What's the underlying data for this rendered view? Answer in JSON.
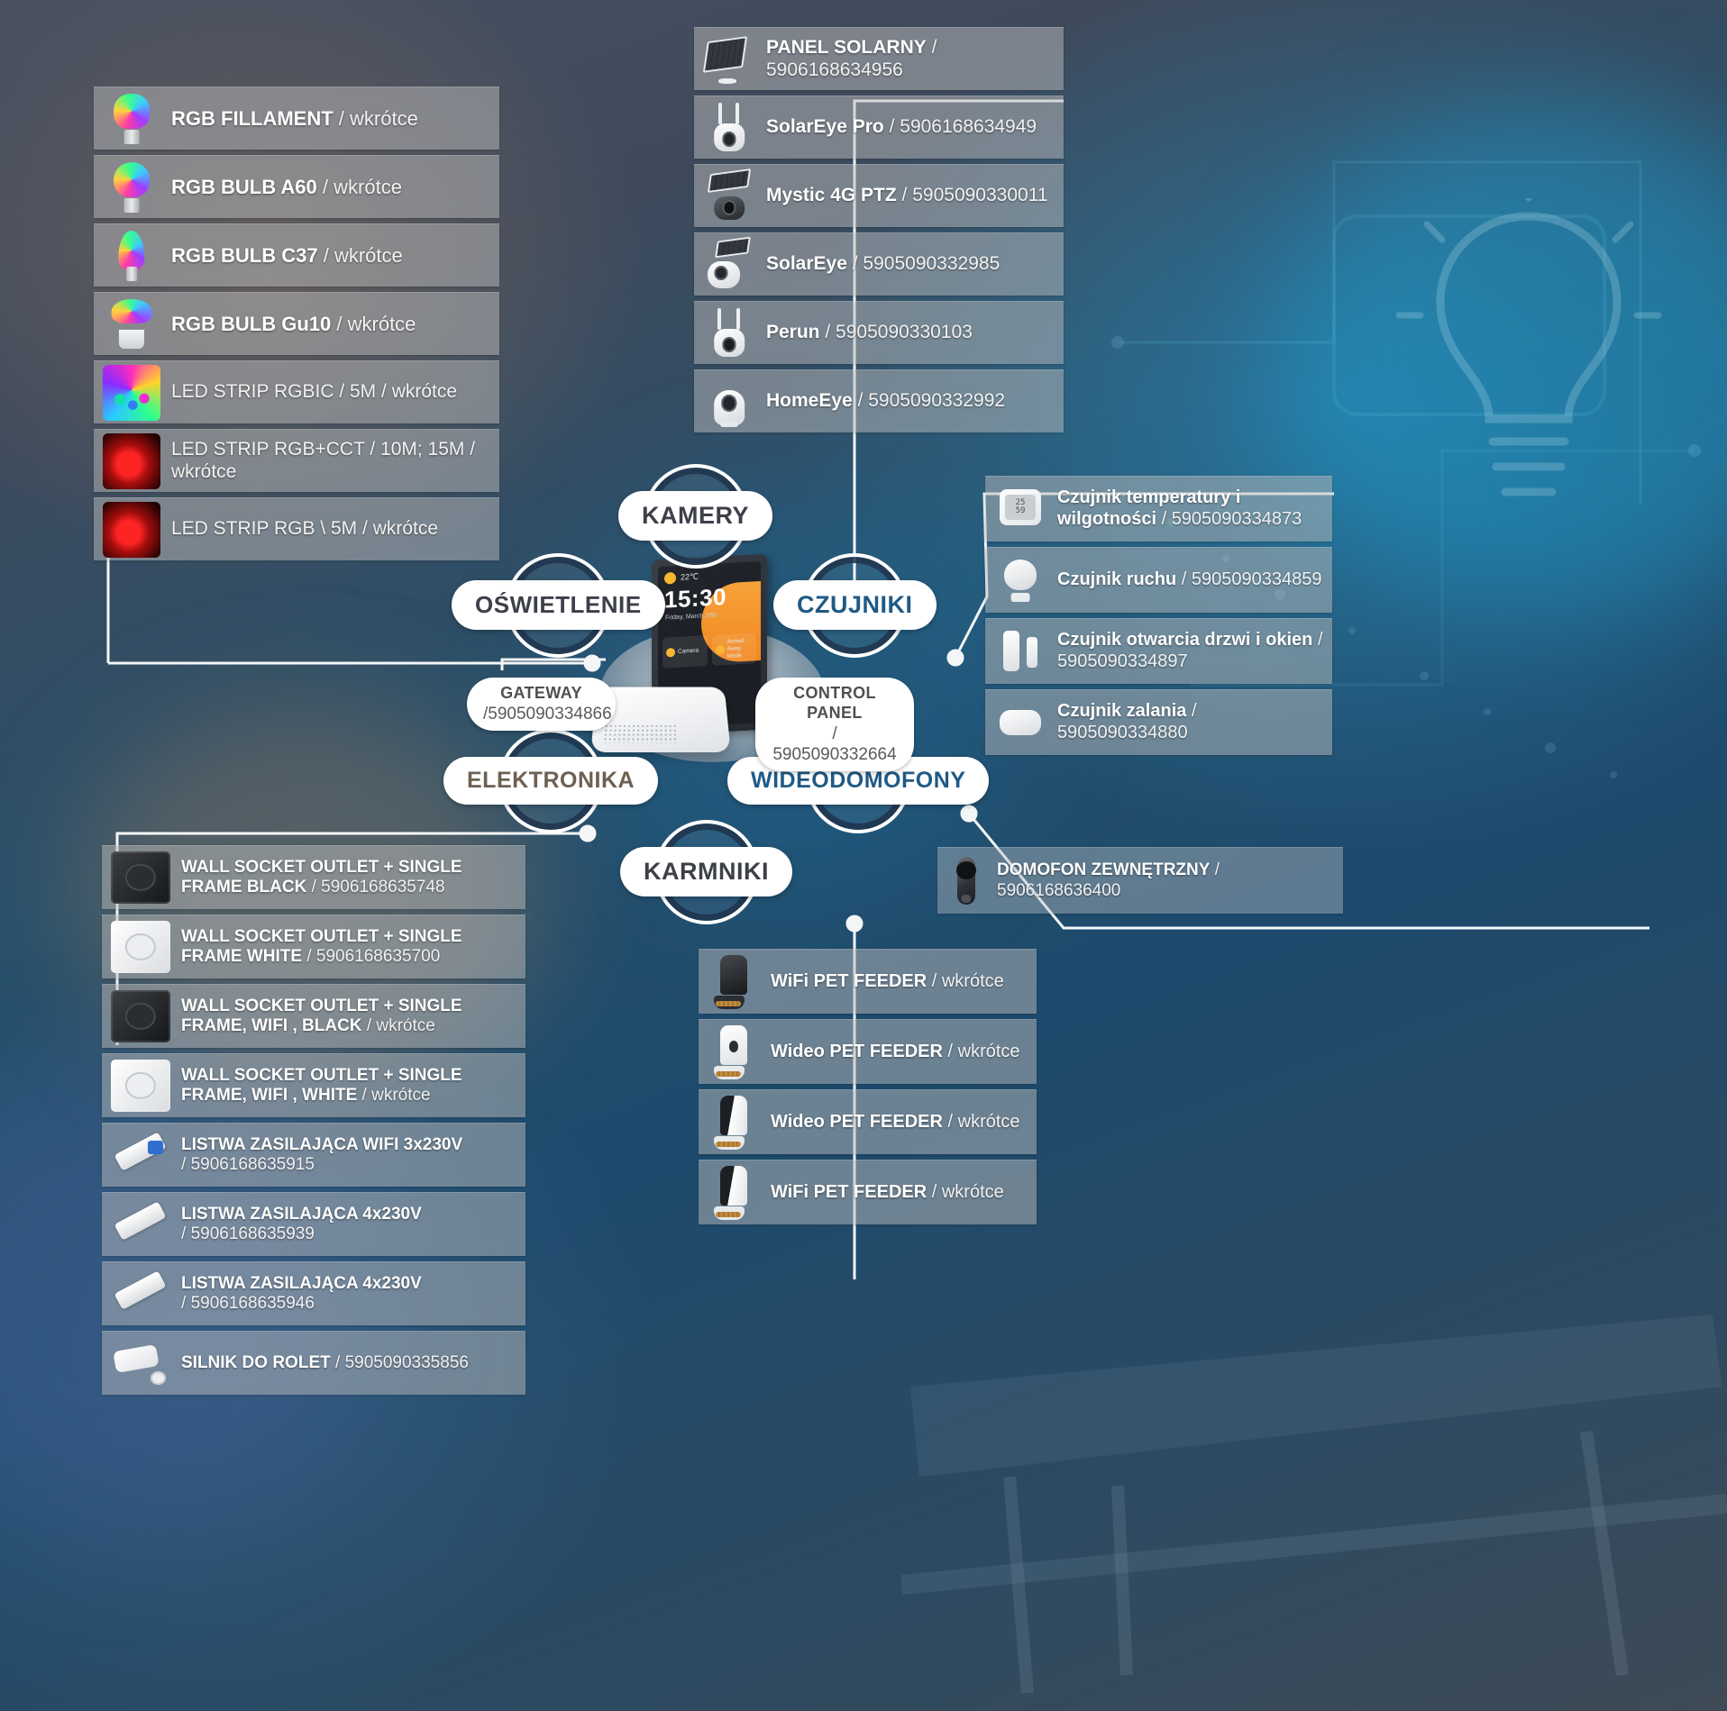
{
  "hub": {
    "nodes": [
      {
        "id": "kamery",
        "label": "KAMERY"
      },
      {
        "id": "oswietlenie",
        "label": "OŚWIETLENIE"
      },
      {
        "id": "czujniki",
        "label": "CZUJNIKI"
      },
      {
        "id": "elektronika",
        "label": "ELEKTRONIKA"
      },
      {
        "id": "wideodomofony",
        "label": "WIDEODOMOFONY"
      },
      {
        "id": "karmniki",
        "label": "KARMNIKI"
      }
    ],
    "gateway": {
      "label": "GATEWAY",
      "code": "/5905090334866"
    },
    "control_panel": {
      "label": "CONTROL PANEL",
      "code": "/ 5905090332664"
    },
    "tablet": {
      "temperature": "22℃",
      "time": "15:30",
      "date": "Friday,  March 28th",
      "card1": "Camera",
      "card2a": "Armed",
      "card2b": "Away Mode"
    }
  },
  "lighting": {
    "items": [
      {
        "name": "RGB FILLAMENT",
        "code": "wkrótce",
        "icon": "rgb-filament-bulb-icon"
      },
      {
        "name": "RGB BULB A60",
        "code": "wkrótce",
        "icon": "rgb-bulb-a60-icon"
      },
      {
        "name": "RGB BULB C37",
        "code": "wkrótce",
        "icon": "rgb-bulb-c37-icon"
      },
      {
        "name": "RGB BULB Gu10",
        "code": "wkrótce",
        "icon": "rgb-bulb-gu10-icon"
      },
      {
        "name": "LED STRIP RGBIC / 5M",
        "code": "wkrótce",
        "icon": "led-strip-rgbic-icon"
      },
      {
        "name": "LED STRIP RGB+CCT / 10M; 15M",
        "code": "wkrótce",
        "icon": "led-strip-rgbcct-icon"
      },
      {
        "name": "LED STRIP RGB \\ 5M",
        "code": "wkrótce",
        "icon": "led-strip-rgb-icon"
      }
    ]
  },
  "cameras": {
    "items": [
      {
        "name": "PANEL SOLARNY",
        "code": "5906168634956",
        "icon": "solar-panel-icon"
      },
      {
        "name": "SolarEye Pro",
        "code": "5906168634949",
        "icon": "ptz-camera-icon"
      },
      {
        "name": "Mystic 4G PTZ",
        "code": "5905090330011",
        "icon": "solar-ptz-camera-icon"
      },
      {
        "name": "SolarEye",
        "code": "5905090332985",
        "icon": "solar-bullet-camera-icon"
      },
      {
        "name": "Perun",
        "code": "5905090330103",
        "icon": "ptz-camera-icon"
      },
      {
        "name": "HomeEye",
        "code": "5905090332992",
        "icon": "indoor-camera-icon"
      }
    ]
  },
  "sensors": {
    "items": [
      {
        "name": "Czujnik temperatury i wilgotności",
        "code": "5905090334873",
        "icon": "temperature-humidity-sensor-icon"
      },
      {
        "name": "Czujnik ruchu",
        "code": "5905090334859",
        "icon": "motion-sensor-icon"
      },
      {
        "name": "Czujnik otwarcia drzwi i okien",
        "code": "5905090334897",
        "icon": "door-window-sensor-icon"
      },
      {
        "name": "Czujnik zalania",
        "code": "5905090334880",
        "icon": "water-leak-sensor-icon"
      }
    ]
  },
  "electronics": {
    "items": [
      {
        "name": "WALL SOCKET OUTLET + SINGLE FRAME BLACK",
        "code": "5906168635748",
        "icon": "wall-socket-black-icon"
      },
      {
        "name": "WALL SOCKET OUTLET + SINGLE FRAME WHITE",
        "code": "5906168635700",
        "icon": "wall-socket-white-icon"
      },
      {
        "name": "WALL SOCKET OUTLET + SINGLE FRAME, WIFI , BLACK",
        "code": "wkrótce",
        "icon": "wall-socket-wifi-black-icon"
      },
      {
        "name": "WALL SOCKET OUTLET + SINGLE FRAME, WIFI , WHITE",
        "code": "wkrótce",
        "icon": "wall-socket-wifi-white-icon"
      },
      {
        "name": "LISTWA ZASILAJĄCA WIFI 3x230V",
        "code": "5906168635915",
        "icon": "power-strip-wifi-icon"
      },
      {
        "name": "LISTWA ZASILAJĄCA 4x230V",
        "code": "5906168635939",
        "icon": "power-strip-icon"
      },
      {
        "name": "LISTWA ZASILAJĄCA 4x230V",
        "code": "5906168635946",
        "icon": "power-strip-icon"
      },
      {
        "name": "SILNIK DO ROLET",
        "code": "5905090335856",
        "icon": "roller-blind-motor-icon"
      }
    ]
  },
  "feeders": {
    "items": [
      {
        "name": "WiFi PET FEEDER",
        "code": "wkrótce",
        "icon": "pet-feeder-black-icon"
      },
      {
        "name": "Wideo PET FEEDER",
        "code": "wkrótce",
        "icon": "video-pet-feeder-white-icon"
      },
      {
        "name": "Wideo PET FEEDER",
        "code": "wkrótce",
        "icon": "video-pet-feeder-icon"
      },
      {
        "name": "WiFi PET FEEDER",
        "code": "wkrótce",
        "icon": "pet-feeder-icon"
      }
    ]
  },
  "doorbell": {
    "items": [
      {
        "name": "DOMOFON ZEWNĘTRZNY",
        "code": "5906168636400",
        "icon": "video-doorbell-icon"
      }
    ]
  },
  "separator": "/",
  "colors": {
    "node_dark": "#3d4049",
    "node_blue": "#1f5a85",
    "node_brown": "#6d6052",
    "panel_bg": "#bababa",
    "text": "#ffffff"
  }
}
